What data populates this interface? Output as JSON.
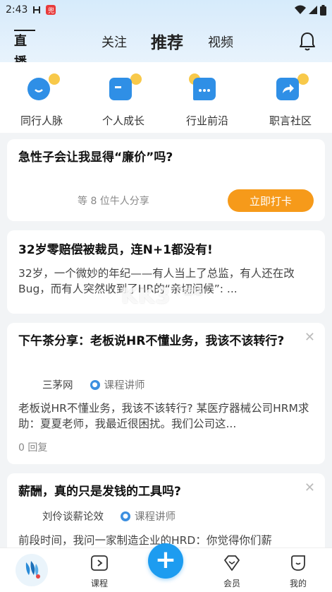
{
  "status_bar": {
    "time": "2:43",
    "app_badge": "兜"
  },
  "header": {
    "live_label": "直播",
    "tabs": [
      {
        "label": "关注"
      },
      {
        "label": "推荐"
      },
      {
        "label": "视频"
      }
    ]
  },
  "quick_entries": [
    {
      "label": "同行人脉",
      "icon": "smile-icon"
    },
    {
      "label": "个人成长",
      "icon": "growth-icon"
    },
    {
      "label": "行业前沿",
      "icon": "chat-bubble-icon"
    },
    {
      "label": "职言社区",
      "icon": "share-arrow-icon"
    }
  ],
  "cards": [
    {
      "title": "急性子会让我显得“廉价”吗?",
      "share_text": "等 8 位牛人分享",
      "button": "立即打卡"
    },
    {
      "title": "32岁零赔偿被裁员，连N+1都没有!",
      "body": "32岁，一个微妙的年纪——有人当上了总监，有人还在改Bug，而有人突然收到了HR的“亲切问候”: ..."
    },
    {
      "title": "下午茶分享：老板说HR不懂业务，我该不该转行?",
      "author": "三茅网",
      "role": "课程讲师",
      "body": "老板说HR不懂业务，我该不该转行? 某医疗器械公司HRM求助：夏夏老师，我最近很困扰。我们公司这...",
      "reply": "0 回复"
    },
    {
      "title": "薪酬，真的只是发钱的工具吗?",
      "author": "刘伶谈薪论效",
      "role": "课程讲师",
      "body": "前段时间，我问一家制造企业的HRD：你觉得你们薪"
    }
  ],
  "watermark": {
    "main": "KK3",
    "sub": "下载站"
  },
  "bottom_nav": [
    {
      "label": ""
    },
    {
      "label": "课程"
    },
    {
      "label": ""
    },
    {
      "label": "会员"
    },
    {
      "label": "我的"
    }
  ],
  "colors": {
    "accent_blue": "#1d9cf0",
    "orange": "#f69a1a",
    "icon_blue": "#2f8fe6",
    "icon_yellow": "#f8c94a"
  }
}
